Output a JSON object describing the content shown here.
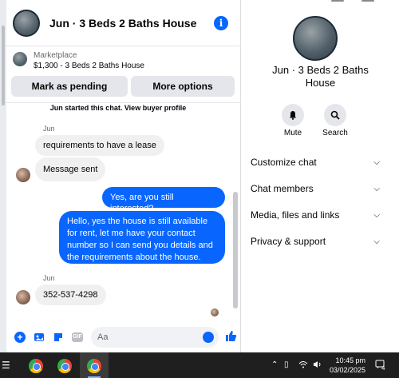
{
  "header": {
    "title": "Jun · 3 Beds 2 Baths House"
  },
  "listing": {
    "category": "Marketplace",
    "price_title": "$1,300 - 3 Beds 2 Baths House",
    "pending_button": "Mark as pending",
    "more_button": "More options"
  },
  "messages": {
    "started_prefix": "Jun started this chat.",
    "started_link": "View buyer profile",
    "sender1": "Jun",
    "in1": "requirements to have a lease",
    "in2": "Message sent",
    "out1": "Yes, are you still interested?",
    "out2": "Hello, yes the house is still available for rent, let me have your contact number so I can send you details and the requirements about the house.",
    "sender2": "Jun",
    "in3": "352-537-4298"
  },
  "composer": {
    "placeholder": "Aa",
    "gif": "GIF"
  },
  "profile": {
    "name": "Jun · 3 Beds 2 Baths House",
    "mute": "Mute",
    "search": "Search",
    "menu": [
      "Customize chat",
      "Chat members",
      "Media, files and links",
      "Privacy & support"
    ]
  },
  "taskbar": {
    "time": "10:45 pm",
    "date": "03/02/2025",
    "notif_count": "4"
  },
  "colors": {
    "accent": "#0866ff",
    "bubble_in": "#f0f0f0",
    "taskbar": "#1f1f1f"
  }
}
